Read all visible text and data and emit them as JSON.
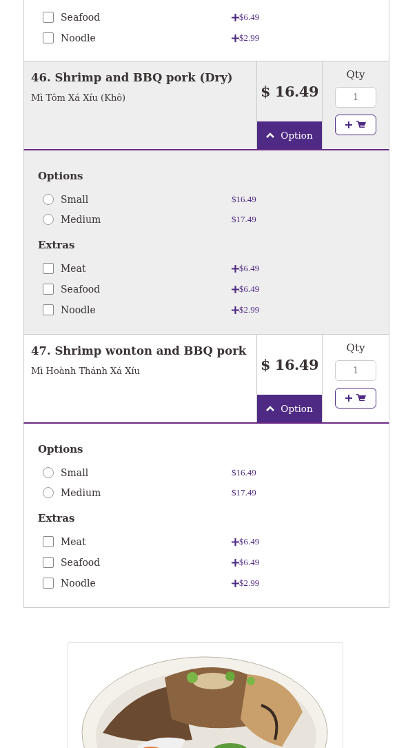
{
  "top_extras": {
    "items": [
      {
        "label": "Seafood",
        "price": "$6.49",
        "checked": false
      },
      {
        "label": "Noodle",
        "price": "$2.99",
        "checked": false
      }
    ]
  },
  "items": [
    {
      "title": "46. Shrimp and BBQ pork (Dry)",
      "subtitle": "Mì Tôm Xá Xíu (Khô)",
      "price": "$ 16.49",
      "qty_label": "Qty",
      "qty": "1",
      "option_button": "Option",
      "expanded": true,
      "highlighted": true,
      "options_heading": "Options",
      "options": [
        {
          "label": "Small",
          "price": "$16.49",
          "selected": false
        },
        {
          "label": "Medium",
          "price": "$17.49",
          "selected": false
        }
      ],
      "extras_heading": "Extras",
      "extras": [
        {
          "label": "Meat",
          "price": "$6.49",
          "checked": false
        },
        {
          "label": "Seafood",
          "price": "$6.49",
          "checked": false
        },
        {
          "label": "Noodle",
          "price": "$2.99",
          "checked": false
        }
      ]
    },
    {
      "title": "47. Shrimp wonton and BBQ pork",
      "subtitle": "Mì Hoành Thánh Xá Xíu",
      "price": "$ 16.49",
      "qty_label": "Qty",
      "qty": "1",
      "option_button": "Option",
      "expanded": true,
      "highlighted": false,
      "options_heading": "Options",
      "options": [
        {
          "label": "Small",
          "price": "$16.49",
          "selected": false
        },
        {
          "label": "Medium",
          "price": "$17.49",
          "selected": false
        }
      ],
      "extras_heading": "Extras",
      "extras": [
        {
          "label": "Meat",
          "price": "$6.49",
          "checked": false
        },
        {
          "label": "Seafood",
          "price": "$6.49",
          "checked": false
        },
        {
          "label": "Noodle",
          "price": "$2.99",
          "checked": false
        }
      ]
    }
  ]
}
